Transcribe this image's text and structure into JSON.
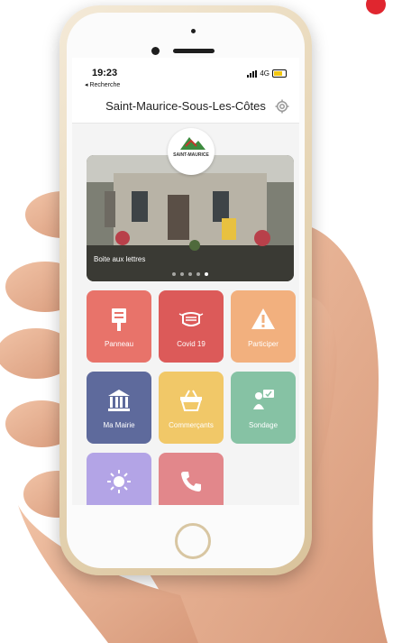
{
  "status_bar": {
    "time": "19:23",
    "back_label": "◂ Recherche",
    "network": "4G"
  },
  "app": {
    "title": "Saint-Maurice-Sous-Les-Côtes",
    "logo_text": "SAINT-MAURICE"
  },
  "hero": {
    "caption": "Boite aux lettres",
    "slide_count": 5,
    "active_slide": 5
  },
  "tiles": [
    {
      "label": "Panneau",
      "color": "#e8736a",
      "icon": "signpost-icon"
    },
    {
      "label": "Covid 19",
      "color": "#dc5a59",
      "icon": "mask-icon"
    },
    {
      "label": "Participer",
      "color": "#f2b07e",
      "icon": "warning-icon"
    },
    {
      "label": "Ma Mairie",
      "color": "#5e6a9c",
      "icon": "town-hall-icon"
    },
    {
      "label": "Commerçants",
      "color": "#f1c868",
      "icon": "basket-icon"
    },
    {
      "label": "Sondage",
      "color": "#86c2a4",
      "icon": "poll-icon"
    },
    {
      "label": "",
      "color": "#b3a4e6",
      "icon": "sun-icon"
    },
    {
      "label": "",
      "color": "#e2878b",
      "icon": "phone-icon"
    }
  ]
}
